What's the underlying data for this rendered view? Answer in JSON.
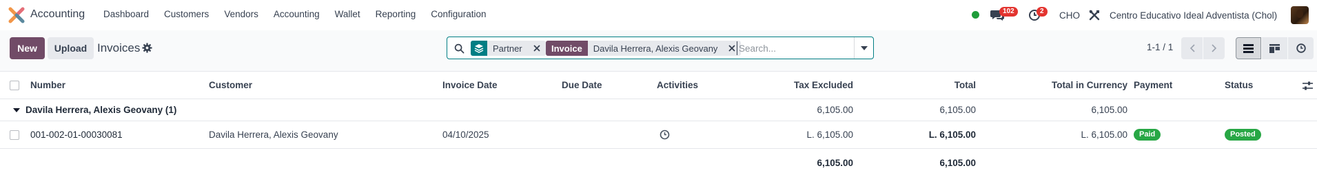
{
  "navbar": {
    "app_name": "Accounting",
    "menu": [
      "Dashboard",
      "Customers",
      "Vendors",
      "Accounting",
      "Wallet",
      "Reporting",
      "Configuration"
    ],
    "messages_count": "102",
    "activities_count": "2",
    "company_code": "CHO",
    "company_name": "Centro Educativo Ideal Adventista (Chol)"
  },
  "control": {
    "new_label": "New",
    "upload_label": "Upload",
    "title": "Invoices",
    "pager": "1-1 / 1"
  },
  "search": {
    "facets": [
      {
        "label": "",
        "value": "Partner",
        "icon": "layers-icon"
      },
      {
        "label": "Invoice",
        "value": "Davila Herrera, Alexis Geovany"
      }
    ],
    "placeholder": "Search..."
  },
  "table": {
    "columns": {
      "number": "Number",
      "customer": "Customer",
      "invoice_date": "Invoice Date",
      "due_date": "Due Date",
      "activities": "Activities",
      "tax_excluded": "Tax Excluded",
      "total": "Total",
      "total_currency": "Total in Currency",
      "payment": "Payment",
      "status": "Status"
    },
    "group": {
      "label": "Davila Herrera, Alexis Geovany (1)",
      "tax_excluded": "6,105.00",
      "total": "6,105.00",
      "total_currency": "6,105.00"
    },
    "rows": [
      {
        "number": "001-002-01-00030081",
        "customer": "Davila Herrera, Alexis Geovany",
        "invoice_date": "04/10/2025",
        "due_date": "",
        "tax_excluded": "L. 6,105.00",
        "total": "L. 6,105.00",
        "total_currency": "L. 6,105.00",
        "payment": "Paid",
        "status": "Posted"
      }
    ],
    "footer": {
      "tax_excluded": "6,105.00",
      "total": "6,105.00"
    }
  },
  "colors": {
    "primary": "#714b67",
    "teal": "#017e84",
    "success": "#28a745",
    "danger": "#e3342f"
  }
}
